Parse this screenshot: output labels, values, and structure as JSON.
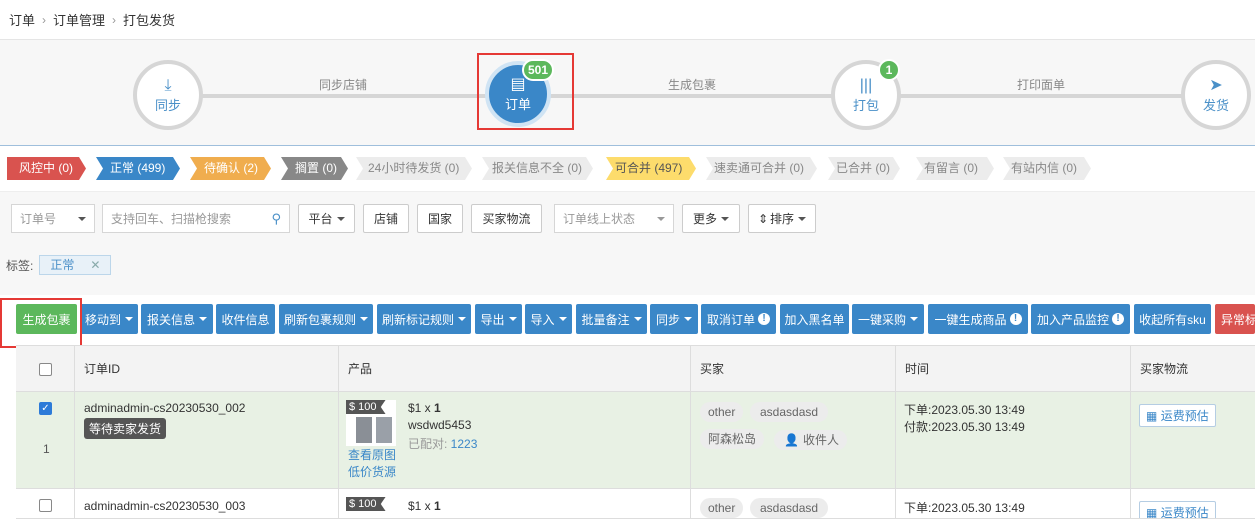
{
  "breadcrumb": [
    "订单",
    "订单管理",
    "打包发货"
  ],
  "workflow": {
    "nodes": [
      {
        "label": "同步",
        "icon": "download-icon"
      },
      {
        "label": "订单",
        "icon": "order-icon",
        "badge": "501"
      },
      {
        "label": "打包",
        "icon": "barcode-icon",
        "badge": "1"
      },
      {
        "label": "发货",
        "icon": "send-icon"
      }
    ],
    "steps": [
      "同步店铺",
      "生成包裹",
      "打印面单"
    ]
  },
  "tabs": [
    {
      "label": "风控中 (0)",
      "color": "#d9534f"
    },
    {
      "label": "正常 (499)",
      "color": "#3a87c8"
    },
    {
      "label": "待确认 (2)",
      "color": "#f0ad4e"
    },
    {
      "label": "搁置 (0)",
      "color": "#888888"
    },
    {
      "label": "24小时待发货 (0)"
    },
    {
      "label": "报关信息不全 (0)"
    },
    {
      "label": "可合并 (497)",
      "color": "#fddc6c"
    },
    {
      "label": "速卖通可合并 (0)"
    },
    {
      "label": "已合并 (0)"
    },
    {
      "label": "有留言 (0)"
    },
    {
      "label": "有站内信 (0)"
    }
  ],
  "filter": {
    "order_no": "订单号",
    "search_placeholder": "支持回车、扫描枪搜索",
    "platform": "平台",
    "shop": "店铺",
    "country": "国家",
    "buyer_logistics": "买家物流",
    "online_status": "订单线上状态",
    "more": "更多",
    "sort": "排序",
    "tag_label": "标签:",
    "tag_value": "正常"
  },
  "actions": [
    "生成包裹",
    "移动到",
    "报关信息",
    "收件信息",
    "刷新包裹规则",
    "刷新标记规则",
    "导出",
    "导入",
    "批量备注",
    "同步",
    "取消订单",
    "加入黑名单",
    "一键采购",
    "一键生成商品",
    "加入产品监控",
    "收起所有sku",
    "异常标"
  ],
  "table": {
    "headers": [
      "订单ID",
      "产品",
      "买家",
      "时间",
      "买家物流"
    ],
    "rows": [
      {
        "order_id": "adminadmin-cs20230530_002",
        "status": "等待卖家发货",
        "index": "1",
        "price_tag": "$ 100",
        "qty_prefix": "$1 x ",
        "qty": "1",
        "sku": "wsdwd5453",
        "paired_label": "已配对: ",
        "paired_value": "1223",
        "view_image": "查看原图",
        "low_price": "低价货源",
        "buyer_chips": [
          "other",
          "asdasdasd",
          "阿森松岛",
          "收件人"
        ],
        "order_time": "下单:2023.05.30 13:49",
        "pay_time": "付款:2023.05.30 13:49",
        "shipping_btn": "运费预估"
      },
      {
        "order_id": "adminadmin-cs20230530_003",
        "price_tag": "$ 100",
        "qty_prefix": "$1 x ",
        "qty": "1",
        "buyer_chips": [
          "other",
          "asdasdasd"
        ],
        "order_time": "下单:2023.05.30 13:49",
        "shipping_btn": "运费预估"
      }
    ]
  }
}
